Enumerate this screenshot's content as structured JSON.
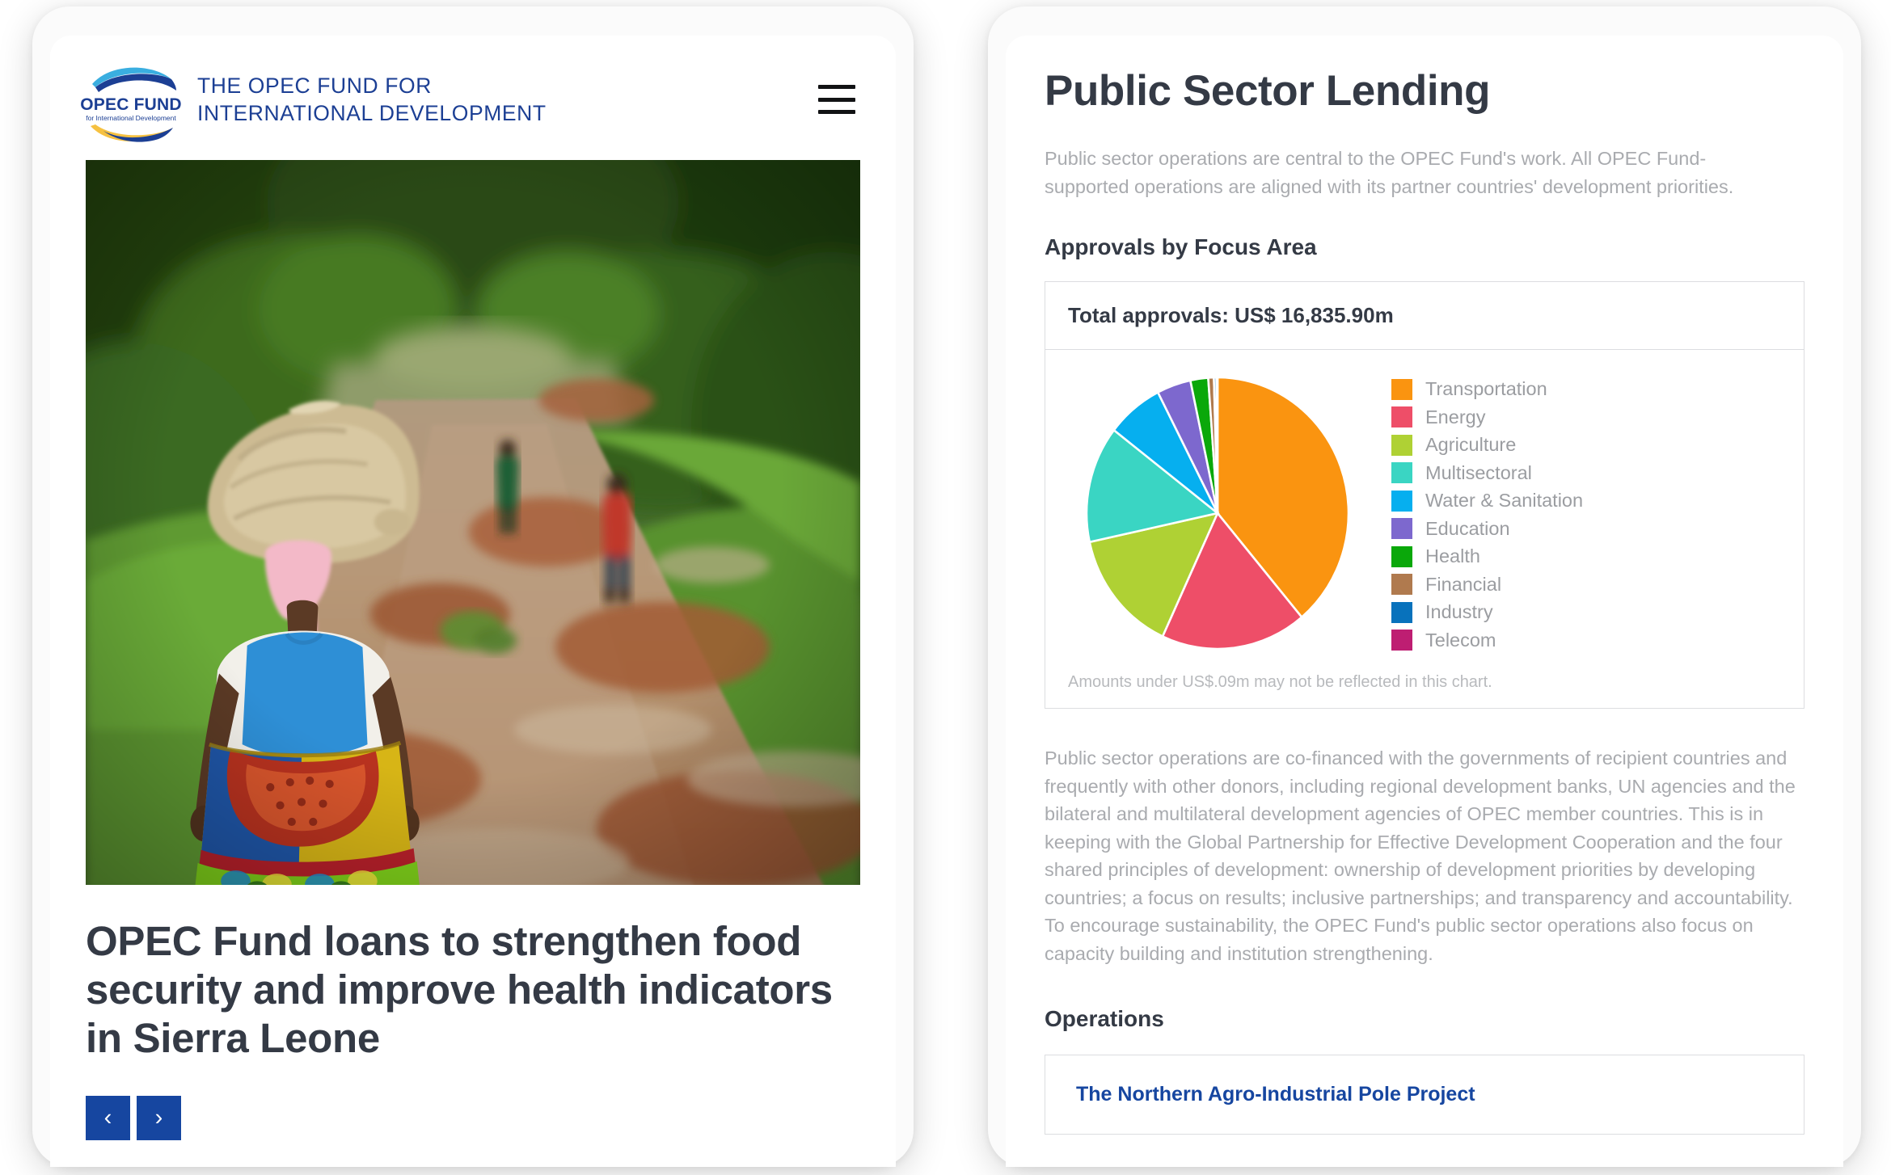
{
  "left_panel": {
    "header": {
      "logo_name": "opec-fund-logo",
      "brand_line1": "THE OPEC FUND FOR",
      "brand_line2": "INTERNATIONAL DEVELOPMENT",
      "brand_text": "THE OPEC FUND FOR\nINTERNATIONAL DEVELOPMENT",
      "menu_icon": "hamburger-menu-icon"
    },
    "hero": {
      "alt": "Woman carrying a large sack on her head walking along a red dirt road lined with green trees, two distant figures ahead",
      "headline": "OPEC Fund loans to strengthen food security and improve health indicators in Sierra Leone"
    },
    "carousel": {
      "prev_label": "‹",
      "next_label": "›",
      "prev_icon": "chevron-left-icon",
      "next_icon": "chevron-right-icon"
    }
  },
  "right_panel": {
    "title": "Public Sector Lending",
    "lede": "Public sector operations are central to the OPEC Fund's work. All OPEC Fund-supported operations are aligned with its partner countries' development priorities.",
    "section_chart_heading": "Approvals by Focus Area",
    "chart_card": {
      "total_label": "Total approvals: US$ 16,835.90m",
      "note": "Amounts under US$.09m may not be reflected in this chart."
    },
    "body_copy": "Public sector operations are co-financed with the governments of recipient countries and frequently with other donors, including regional development banks, UN agencies and the bilateral and multilateral development agencies of OPEC member countries. This is in keeping with the Global Partnership for Effective Development Cooperation and the four shared principles of development: ownership of development priorities by developing countries; a focus on results; inclusive partnerships; and transparency and accountability. To encourage sustainability, the OPEC Fund's public sector operations also focus on capacity building and institution strengthening.",
    "section_operations_heading": "Operations",
    "operations": [
      {
        "title": "The Northern Agro-Industrial Pole Project"
      }
    ]
  },
  "colors": {
    "brand_blue": "#1c3f94",
    "link_blue": "#1646a0",
    "heading": "#343a45",
    "muted_text": "#a9abaf",
    "card_border": "#dcdde0"
  },
  "chart_data": {
    "type": "pie",
    "title": "Approvals by Focus Area",
    "total_label": "Total approvals: US$ 16,835.90m",
    "total_value": 16835.9,
    "unit": "US$ million",
    "note": "Amounts under US$.09m may not be reflected in this chart.",
    "legend_position": "right",
    "start_angle_deg": 0,
    "direction": "clockwise",
    "categories": [
      "Transportation",
      "Energy",
      "Agriculture",
      "Multisectoral",
      "Water & Sanitation",
      "Education",
      "Health",
      "Financial",
      "Industry",
      "Telecom"
    ],
    "colors": [
      "#FA9410",
      "#EE4E68",
      "#AFD134",
      "#3AD5C3",
      "#06AFEF",
      "#7D68CE",
      "#0AA80A",
      "#B07A4E",
      "#0872BC",
      "#BE1E72"
    ],
    "percentages": [
      38.9,
      18.0,
      14.7,
      13.9,
      7.0,
      4.2,
      2.2,
      0.7,
      0.3,
      0.1
    ],
    "values": [
      6549.2,
      3030.5,
      2474.9,
      2340.2,
      1178.5,
      707.1,
      370.4,
      117.9,
      50.5,
      16.8
    ],
    "slices": [
      {
        "label": "Transportation",
        "color": "#FA9410",
        "percent": 38.9,
        "start_deg": 0.0,
        "end_deg": 140.0
      },
      {
        "label": "Energy",
        "color": "#EE4E68",
        "percent": 18.0,
        "start_deg": 140.0,
        "end_deg": 204.8
      },
      {
        "label": "Agriculture",
        "color": "#AFD134",
        "percent": 14.7,
        "start_deg": 204.8,
        "end_deg": 257.7
      },
      {
        "label": "Multisectoral",
        "color": "#3AD5C3",
        "percent": 13.9,
        "start_deg": 257.7,
        "end_deg": 307.7
      },
      {
        "label": "Water & Sanitation",
        "color": "#06AFEF",
        "percent": 7.0,
        "start_deg": 307.7,
        "end_deg": 332.9
      },
      {
        "label": "Education",
        "color": "#7D68CE",
        "percent": 4.2,
        "start_deg": 332.9,
        "end_deg": 348.0
      },
      {
        "label": "Health",
        "color": "#0AA80A",
        "percent": 2.2,
        "start_deg": 348.0,
        "end_deg": 355.9
      },
      {
        "label": "Financial",
        "color": "#B07A4E",
        "percent": 0.7,
        "start_deg": 355.9,
        "end_deg": 358.4
      },
      {
        "label": "Industry",
        "color": "#0872BC",
        "percent": 0.3,
        "start_deg": 358.4,
        "end_deg": 359.5
      },
      {
        "label": "Telecom",
        "color": "#BE1E72",
        "percent": 0.1,
        "start_deg": 359.5,
        "end_deg": 360.0
      }
    ]
  }
}
